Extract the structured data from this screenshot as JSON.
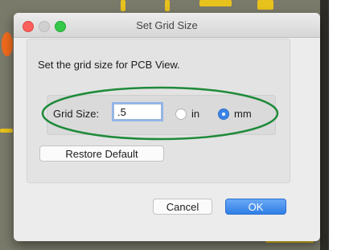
{
  "window": {
    "title": "Set Grid Size"
  },
  "dialog": {
    "prompt": "Set the grid size for PCB View.",
    "grid_size_label": "Grid Size:",
    "grid_size_value": ".5",
    "units": [
      {
        "label": "in",
        "selected": false
      },
      {
        "label": "mm",
        "selected": true
      }
    ],
    "restore_default_label": "Restore Default",
    "cancel_label": "Cancel",
    "ok_label": "OK"
  },
  "colors": {
    "accent": "#3a83e8",
    "highlight_ellipse": "#1e8a3a",
    "pcb_trace": "#e8c21c",
    "pcb_pad": "#f06a1c"
  }
}
